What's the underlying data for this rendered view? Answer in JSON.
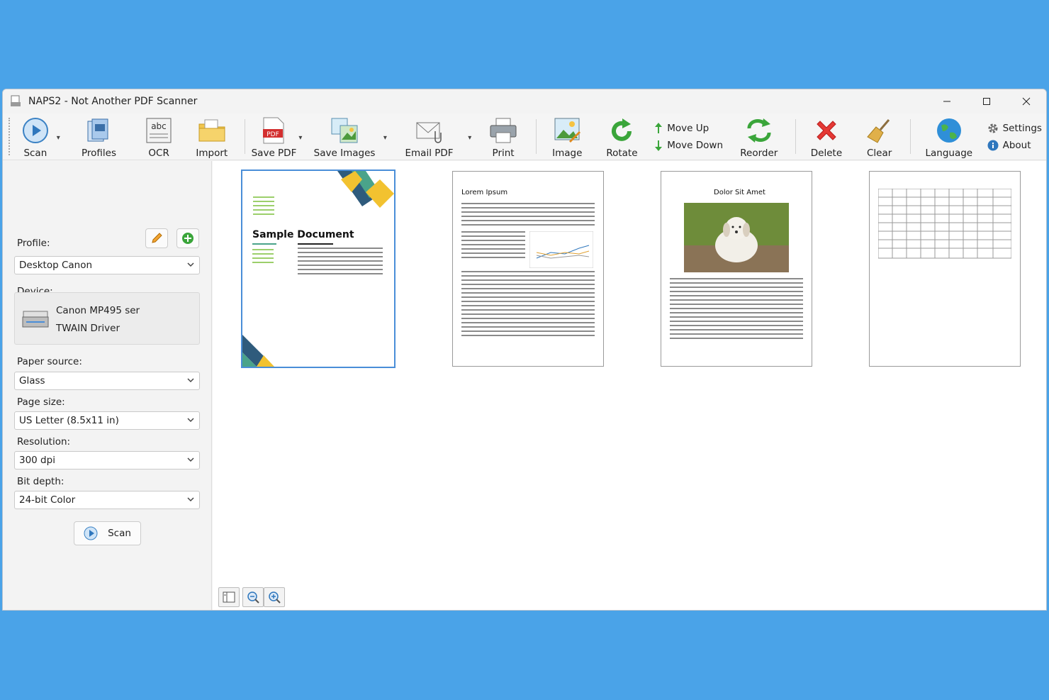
{
  "window": {
    "title": "NAPS2 - Not Another PDF Scanner"
  },
  "toolbar": {
    "scan": "Scan",
    "profiles": "Profiles",
    "ocr": "OCR",
    "import": "Import",
    "save_pdf": "Save PDF",
    "save_images": "Save Images",
    "email_pdf": "Email PDF",
    "print": "Print",
    "image": "Image",
    "rotate": "Rotate",
    "move_up": "Move Up",
    "move_down": "Move Down",
    "reorder": "Reorder",
    "delete": "Delete",
    "clear": "Clear",
    "language": "Language",
    "settings": "Settings",
    "about": "About",
    "ocr_icon_text": "abc",
    "pdf_icon_text": "PDF"
  },
  "sidebar": {
    "profile_label": "Profile:",
    "profile_value": "Desktop Canon",
    "device_label": "Device:",
    "device_name": "Canon MP495 ser",
    "device_driver": "TWAIN Driver",
    "paper_source_label": "Paper source:",
    "paper_source_value": "Glass",
    "page_size_label": "Page size:",
    "page_size_value": "US Letter (8.5x11 in)",
    "resolution_label": "Resolution:",
    "resolution_value": "300 dpi",
    "bit_depth_label": "Bit depth:",
    "bit_depth_value": "24-bit Color",
    "scan_button": "Scan"
  },
  "pages": [
    {
      "title": "Sample Document",
      "selected": true
    },
    {
      "title": "Lorem Ipsum",
      "selected": false
    },
    {
      "title": "Dolor Sit Amet",
      "selected": false
    },
    {
      "title": "",
      "selected": false
    }
  ],
  "colors": {
    "background": "#4aa3e8",
    "selection": "#4a8ed8",
    "accent_green": "#3aa53a",
    "delete_red": "#e53935"
  }
}
